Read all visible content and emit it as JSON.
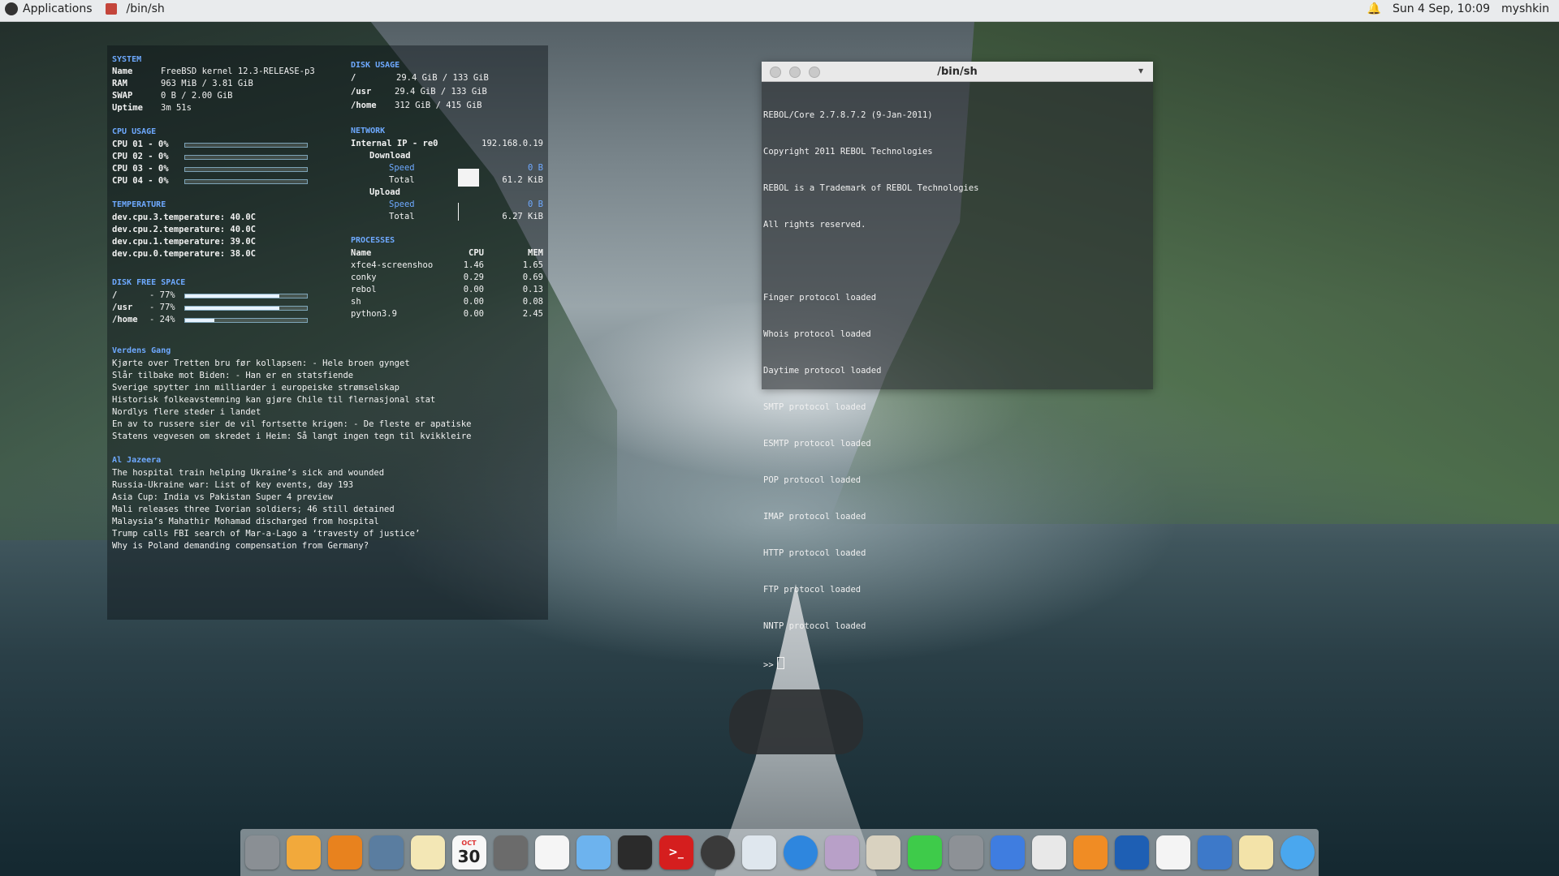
{
  "topbar": {
    "applications": "Applications",
    "window_title": "/bin/sh",
    "datetime": "Sun  4 Sep, 10:09",
    "user": "myshkin"
  },
  "conky": {
    "system": {
      "heading": "SYSTEM",
      "rows": [
        {
          "label": "Name",
          "value": "FreeBSD kernel 12.3-RELEASE-p3"
        },
        {
          "label": "RAM",
          "value": "963 MiB / 3.81 GiB"
        },
        {
          "label": "SWAP",
          "value": "0 B / 2.00 GiB"
        },
        {
          "label": "Uptime",
          "value": "3m 51s"
        }
      ]
    },
    "cpu": {
      "heading": "CPU USAGE",
      "rows": [
        {
          "label": "CPU 01 - 0%",
          "percent": 0
        },
        {
          "label": "CPU 02 - 0%",
          "percent": 0
        },
        {
          "label": "CPU 03 - 0%",
          "percent": 0
        },
        {
          "label": "CPU 04 - 0%",
          "percent": 0
        }
      ]
    },
    "temperature": {
      "heading": "TEMPERATURE",
      "rows": [
        "dev.cpu.3.temperature: 40.0C",
        "dev.cpu.2.temperature: 40.0C",
        "dev.cpu.1.temperature: 39.0C",
        "dev.cpu.0.temperature: 38.0C"
      ]
    },
    "disk_free": {
      "heading": "DISK FREE SPACE",
      "rows": [
        {
          "label": "/",
          "value": "- 77%",
          "percent": 77
        },
        {
          "label": "/usr",
          "value": "- 77%",
          "percent": 77
        },
        {
          "label": "/home",
          "value": "- 24%",
          "percent": 24
        }
      ]
    },
    "disk_usage": {
      "heading": "DISK USAGE",
      "rows": [
        {
          "label": "/",
          "value": "29.4 GiB / 133 GiB"
        },
        {
          "label": "/usr",
          "value": "29.4 GiB / 133 GiB"
        },
        {
          "label": "/home",
          "value": "312 GiB / 415 GiB"
        }
      ]
    },
    "network": {
      "heading": "NETWORK",
      "internal_label": "Internal IP - re0",
      "internal_ip": "192.168.0.19",
      "download": {
        "label": "Download",
        "speed_label": "Speed",
        "speed": "0 B",
        "total_label": "Total",
        "total": "61.2 KiB"
      },
      "upload": {
        "label": "Upload",
        "speed_label": "Speed",
        "speed": "0 B",
        "total_label": "Total",
        "total": "6.27 KiB"
      }
    },
    "processes": {
      "heading": "PROCESSES",
      "columns": [
        "Name",
        "CPU",
        "MEM"
      ],
      "rows": [
        {
          "name": "xfce4-screenshoo",
          "cpu": "1.46",
          "mem": "1.65"
        },
        {
          "name": "conky",
          "cpu": "0.29",
          "mem": "0.69"
        },
        {
          "name": "rebol",
          "cpu": "0.00",
          "mem": "0.13"
        },
        {
          "name": "sh",
          "cpu": "0.00",
          "mem": "0.08"
        },
        {
          "name": "python3.9",
          "cpu": "0.00",
          "mem": "2.45"
        }
      ]
    },
    "news_vg": {
      "heading": "Verdens Gang",
      "items": [
        "Kjørte over Tretten bru før kollapsen: - Hele broen gynget",
        "Slår tilbake mot Biden: - Han er en statsfiende",
        "Sverige spytter inn milliarder i europeiske strømselskap",
        "Historisk folkeavstemning kan gjøre Chile til flernasjonal stat",
        "Nordlys flere steder i landet",
        "En av to russere sier de vil fortsette krigen: - De fleste er apatiske",
        "Statens vegvesen om skredet i Heim: Så langt ingen tegn til kvikkleire"
      ]
    },
    "news_aj": {
      "heading": "Al Jazeera",
      "items": [
        "The hospital train helping Ukraine’s sick and wounded",
        "Russia-Ukraine war: List of key events, day 193",
        "Asia Cup: India vs Pakistan Super 4 preview",
        "Mali releases three Ivorian soldiers; 46 still detained",
        "Malaysia’s Mahathir Mohamad discharged from hospital",
        "Trump calls FBI search of Mar-a-Lago a ‘travesty of justice’",
        "Why is Poland demanding compensation from Germany?"
      ]
    }
  },
  "terminal": {
    "title": "/bin/sh",
    "lines": [
      "REBOL/Core 2.7.8.7.2 (9-Jan-2011)",
      "Copyright 2011 REBOL Technologies",
      "REBOL is a Trademark of REBOL Technologies",
      "All rights reserved.",
      "",
      "Finger protocol loaded",
      "Whois protocol loaded",
      "Daytime protocol loaded",
      "SMTP protocol loaded",
      "ESMTP protocol loaded",
      "POP protocol loaded",
      "IMAP protocol loaded",
      "HTTP protocol loaded",
      "FTP protocol loaded",
      "NNTP protocol loaded"
    ],
    "prompt": ">>"
  },
  "dock": {
    "calendar_month": "OCT",
    "calendar_day": "30",
    "icons": [
      {
        "name": "finder-icon",
        "color": "#8a8f94"
      },
      {
        "name": "photos-icon",
        "color": "#f2a93b"
      },
      {
        "name": "books-icon",
        "color": "#e8821e"
      },
      {
        "name": "image-capture-icon",
        "color": "#5a7da0"
      },
      {
        "name": "notes-icon",
        "color": "#f3e7b5"
      },
      {
        "name": "calendar-icon",
        "color": "#f7f7f7"
      },
      {
        "name": "calculator-icon",
        "color": "#6b6b6b"
      },
      {
        "name": "reminders-icon",
        "color": "#f5f5f5"
      },
      {
        "name": "folder-icon",
        "color": "#6db3ee"
      },
      {
        "name": "network-icon",
        "color": "#2b2b2b"
      },
      {
        "name": "terminal-icon",
        "color": "#d51e1e"
      },
      {
        "name": "screenshot-icon",
        "color": "#3a3a3a"
      },
      {
        "name": "preview-icon",
        "color": "#dfe7ee"
      },
      {
        "name": "safari-icon",
        "color": "#2e86de"
      },
      {
        "name": "mail-icon",
        "color": "#b8a0c8"
      },
      {
        "name": "script-editor-icon",
        "color": "#d9d2c0"
      },
      {
        "name": "messages-icon",
        "color": "#3ecb4a"
      },
      {
        "name": "system-preferences-icon",
        "color": "#8d9196"
      },
      {
        "name": "itunes-icon",
        "color": "#3f7de0"
      },
      {
        "name": "printer-icon",
        "color": "#e8e8e8"
      },
      {
        "name": "pages-icon",
        "color": "#f08c24"
      },
      {
        "name": "quicktime-icon",
        "color": "#1e5fb4"
      },
      {
        "name": "numbers-icon",
        "color": "#f4f4f4"
      },
      {
        "name": "keynote-icon",
        "color": "#3d79c9"
      },
      {
        "name": "textedit-icon",
        "color": "#f3e3a9"
      },
      {
        "name": "weather-icon",
        "color": "#4aa7ee"
      }
    ]
  }
}
